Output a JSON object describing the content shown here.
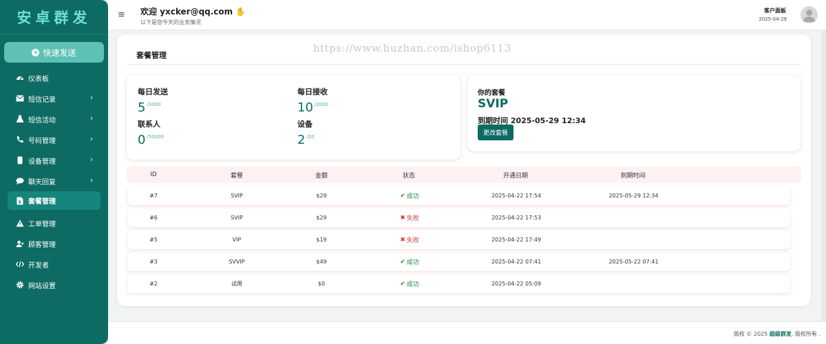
{
  "brand": "安卓群发",
  "sidebar": {
    "quick_send": "快速发送",
    "items": [
      {
        "label": "仪表板",
        "has_chevron": false
      },
      {
        "label": "短信记录",
        "has_chevron": true
      },
      {
        "label": "短信活动",
        "has_chevron": true
      },
      {
        "label": "号码管理",
        "has_chevron": true
      },
      {
        "label": "设备管理",
        "has_chevron": true
      },
      {
        "label": "聊天回复",
        "has_chevron": true
      },
      {
        "label": "套餐管理",
        "has_chevron": false,
        "active": true
      },
      {
        "label": "工单管理",
        "has_chevron": false
      },
      {
        "label": "顾客管理",
        "has_chevron": false
      },
      {
        "label": "开发者",
        "has_chevron": false
      },
      {
        "label": "网站设置",
        "has_chevron": false
      }
    ]
  },
  "header": {
    "welcome": "欢迎 yxcker@qq.com",
    "subtitle": "以下是您今天的业务情况",
    "panel_title": "客户面板",
    "panel_date": "2025-04-29"
  },
  "main": {
    "title": "套餐管理",
    "watermark": "https://www.huzhan.com/ishop6113",
    "stats": {
      "daily_send": {
        "label": "每日发送",
        "value": "5",
        "limit": "/3000"
      },
      "daily_receive": {
        "label": "每日接收",
        "value": "10",
        "limit": "/2000"
      },
      "contacts": {
        "label": "联系人",
        "value": "0",
        "limit": "/50000"
      },
      "devices": {
        "label": "设备",
        "value": "2",
        "limit": "/20"
      }
    },
    "plan": {
      "label": "你的套餐",
      "name": "SVIP",
      "expire": "到期时间 2025-05-29 12:34",
      "change_button": "更改套餐"
    },
    "table": {
      "headers": {
        "id": "ID",
        "plan": "套餐",
        "amount": "金额",
        "status": "状态",
        "open_date": "开通日期",
        "expire_date": "到期时间"
      },
      "rows": [
        {
          "id": "#7",
          "plan": "SVIP",
          "amount": "$29",
          "status": "成功",
          "ok": true,
          "open_date": "2025-04-22 17:54",
          "expire_date": "2025-05-29 12:34"
        },
        {
          "id": "#6",
          "plan": "SVIP",
          "amount": "$29",
          "status": "失败",
          "ok": false,
          "open_date": "2025-04-22 17:53",
          "expire_date": ""
        },
        {
          "id": "#5",
          "plan": "VIP",
          "amount": "$19",
          "status": "失败",
          "ok": false,
          "open_date": "2025-04-22 17:49",
          "expire_date": ""
        },
        {
          "id": "#3",
          "plan": "SVVIP",
          "amount": "$49",
          "status": "成功",
          "ok": true,
          "open_date": "2025-04-22 07:41",
          "expire_date": "2025-05-22 07:41"
        },
        {
          "id": "#2",
          "plan": "试用",
          "amount": "$0",
          "status": "成功",
          "ok": true,
          "open_date": "2025-04-22 05:09",
          "expire_date": ""
        }
      ]
    }
  },
  "footer": {
    "prefix": "版权 © 2025 ",
    "brand": "超级群发",
    "suffix": ". 版权所有 ."
  },
  "colors": {
    "primary": "#0d6b63",
    "accent": "#5fc0b5",
    "success": "#1d8a4c",
    "danger": "#d23c3c"
  }
}
